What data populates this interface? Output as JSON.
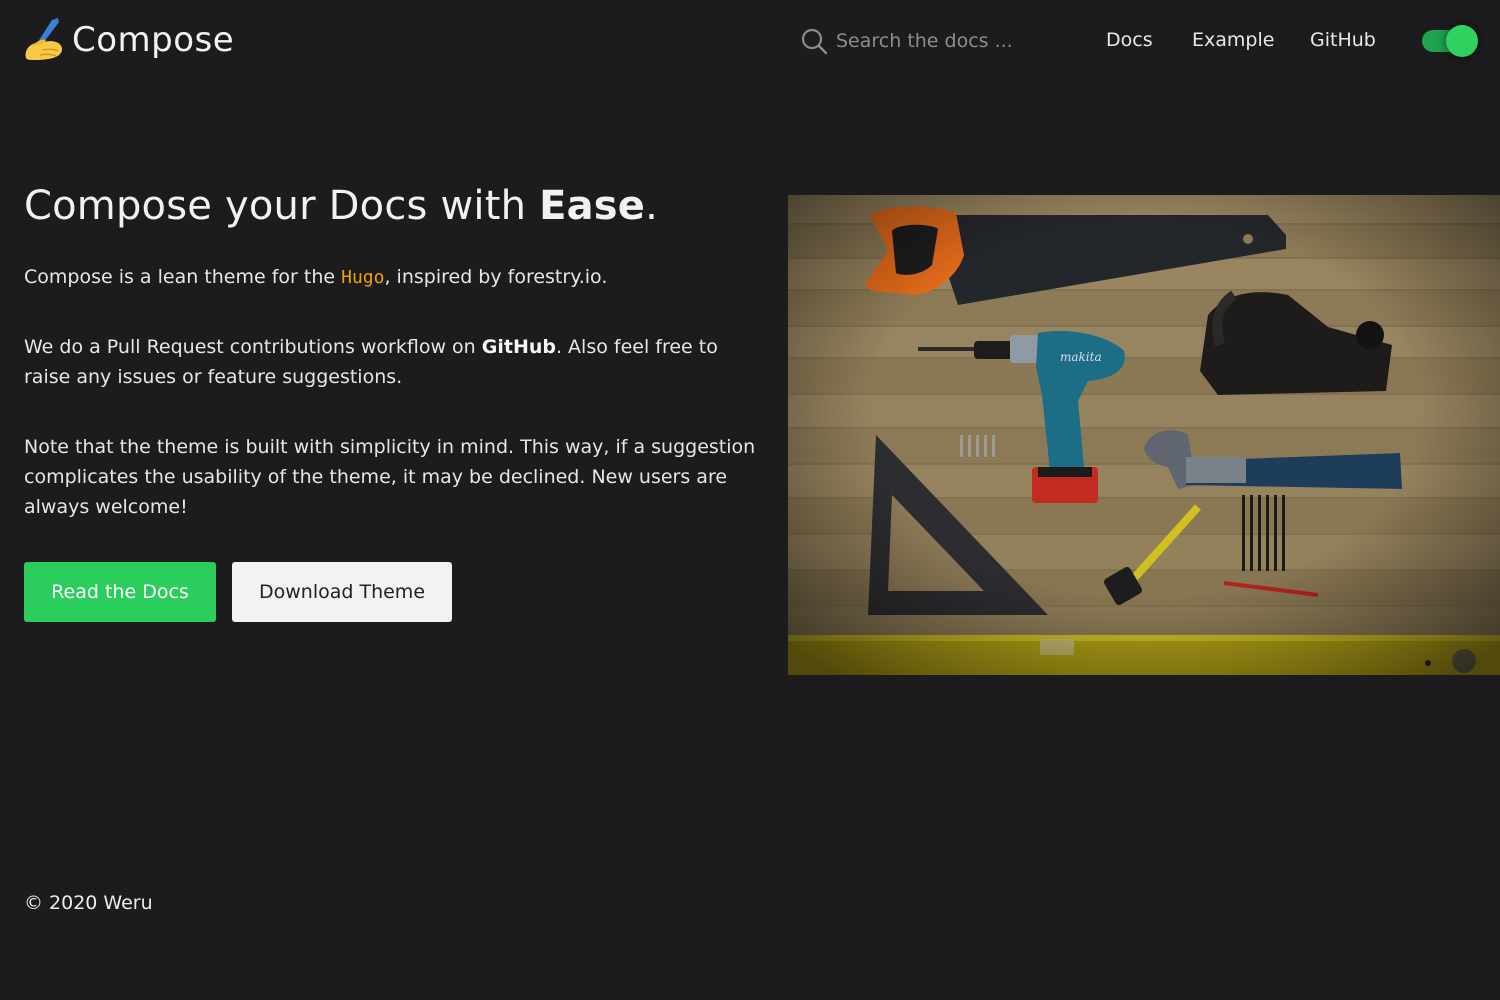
{
  "header": {
    "logo_text": "Compose",
    "search_placeholder": "Search the docs ...",
    "nav": {
      "docs": "Docs",
      "example": "Example",
      "github": "GitHub"
    },
    "dark_mode_toggle": "on",
    "accent_color": "#2bcd5c"
  },
  "hero": {
    "title_plain": "Compose your Docs with ",
    "title_strong": "Ease",
    "title_end": ".",
    "p1_before": "Compose is a lean theme for the ",
    "p1_code": "Hugo",
    "p1_after": ", inspired by forestry.io.",
    "p2_before": "We do a Pull Request contributions workflow on ",
    "p2_bold": "GitHub",
    "p2_after": ". Also feel free to raise any issues or feature suggestions.",
    "p3": "Note that the theme is built with simplicity in mind. This way, if a suggestion complicates the usability of the theme, it may be declined. New users are always welcome!",
    "button_read": "Read the Docs",
    "button_download": "Download Theme"
  },
  "image": {
    "drill_brand": "makita"
  },
  "footer": {
    "copyright": "© 2020 Weru"
  }
}
